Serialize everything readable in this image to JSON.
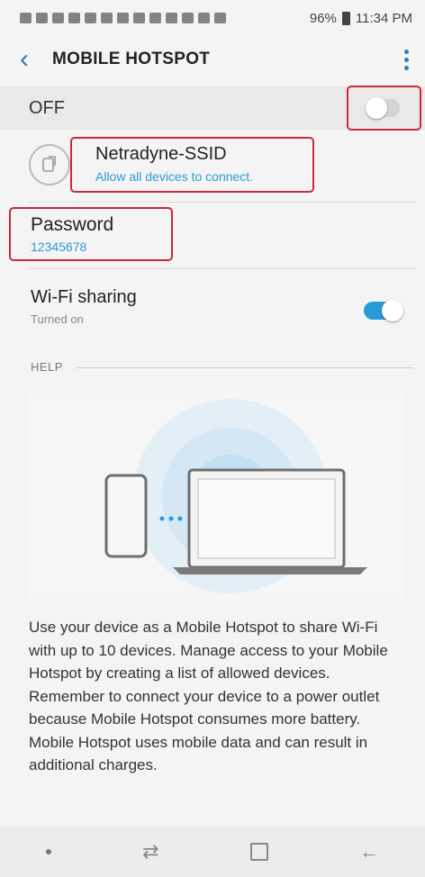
{
  "status_bar": {
    "battery": "96%",
    "time": "11:34 PM"
  },
  "header": {
    "back_icon": "chevron-left-icon",
    "title": "MOBILE HOTSPOT",
    "more_icon": "more-vert-icon"
  },
  "hotspot": {
    "state_label": "OFF",
    "enabled": false
  },
  "network": {
    "icon": "qr-share-icon",
    "name": "Netradyne-SSID",
    "subtitle": "Allow all devices to connect."
  },
  "password": {
    "label": "Password",
    "value": "12345678"
  },
  "wifi_sharing": {
    "label": "Wi-Fi sharing",
    "status": "Turned on",
    "enabled": true
  },
  "help": {
    "section_label": "HELP",
    "illustration": "phone-to-laptop-hotspot-illustration",
    "description": "Use your device as a Mobile Hotspot to share Wi-Fi with up to 10 devices. Manage access to your Mobile Hotspot by creating a list of allowed devices. Remember to connect your device to a power outlet because Mobile Hotspot consumes more battery. Mobile Hotspot uses mobile data and can result in additional charges."
  },
  "colors": {
    "accent": "#2a9ad6",
    "highlight_border": "#c9283e"
  },
  "nav_bar": {
    "items": [
      "nav-dot-icon",
      "recent-apps-icon",
      "home-icon",
      "back-arrow-icon"
    ]
  }
}
